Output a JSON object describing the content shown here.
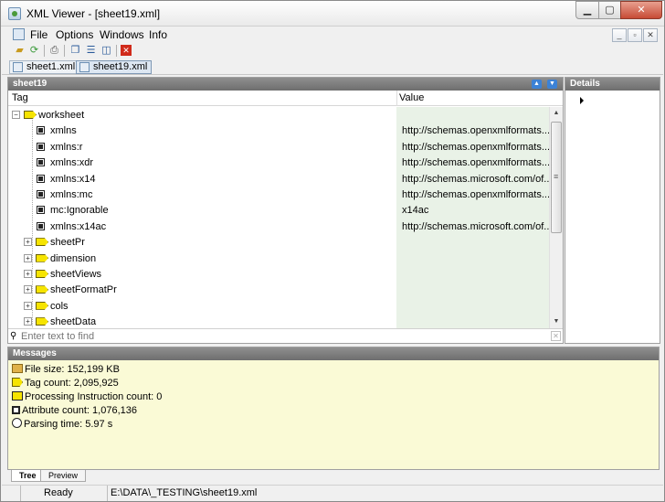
{
  "window": {
    "title": "XML Viewer - [sheet19.xml]"
  },
  "menu": [
    "File",
    "Options",
    "Windows",
    "Info"
  ],
  "file_tabs": [
    "sheet1.xml",
    "sheet19.xml"
  ],
  "tree_panel": {
    "title": "sheet19",
    "columns": {
      "tag": "Tag",
      "value": "Value"
    },
    "rows": [
      {
        "tag": "worksheet",
        "value": "",
        "kind": "element",
        "expander": "−"
      },
      {
        "tag": "xmlns",
        "value": "http://schemas.openxmlformats....",
        "kind": "attribute"
      },
      {
        "tag": "xmlns:r",
        "value": "http://schemas.openxmlformats....",
        "kind": "attribute"
      },
      {
        "tag": "xmlns:xdr",
        "value": "http://schemas.openxmlformats....",
        "kind": "attribute"
      },
      {
        "tag": "xmlns:x14",
        "value": "http://schemas.microsoft.com/of...",
        "kind": "attribute"
      },
      {
        "tag": "xmlns:mc",
        "value": "http://schemas.openxmlformats....",
        "kind": "attribute"
      },
      {
        "tag": "mc:Ignorable",
        "value": "x14ac",
        "kind": "attribute"
      },
      {
        "tag": "xmlns:x14ac",
        "value": "http://schemas.microsoft.com/of...",
        "kind": "attribute"
      },
      {
        "tag": "sheetPr",
        "value": "",
        "kind": "element",
        "expander": "+"
      },
      {
        "tag": "dimension",
        "value": "",
        "kind": "element",
        "expander": "+"
      },
      {
        "tag": "sheetViews",
        "value": "",
        "kind": "element",
        "expander": "+"
      },
      {
        "tag": "sheetFormatPr",
        "value": "",
        "kind": "element",
        "expander": "+"
      },
      {
        "tag": "cols",
        "value": "",
        "kind": "element",
        "expander": "+"
      },
      {
        "tag": "sheetData",
        "value": "",
        "kind": "element",
        "expander": "+"
      }
    ],
    "find_placeholder": "Enter text to find"
  },
  "details_panel": {
    "title": "Details"
  },
  "messages_panel": {
    "title": "Messages",
    "items": [
      {
        "icon": "folder-icon",
        "text": "File size: 152,199 KB"
      },
      {
        "icon": "tag-icon",
        "text": "Tag count: 2,095,925"
      },
      {
        "icon": "processing-instruction-icon",
        "text": "Processing Instruction count: 0"
      },
      {
        "icon": "attribute-icon",
        "text": "Attribute count: 1,076,136"
      },
      {
        "icon": "clock-icon",
        "text": "Parsing time: 5.97 s"
      }
    ]
  },
  "bottom_tabs": [
    "Tree",
    "Preview"
  ],
  "status": {
    "state": "Ready",
    "path": "E:\\DATA\\_TESTING\\sheet19.xml"
  },
  "colors": {
    "value_column_bg": "#e9f2e7",
    "messages_bg": "#fafad6",
    "panel_header": "#7a7a7a",
    "element_icon": "#f6e400"
  }
}
